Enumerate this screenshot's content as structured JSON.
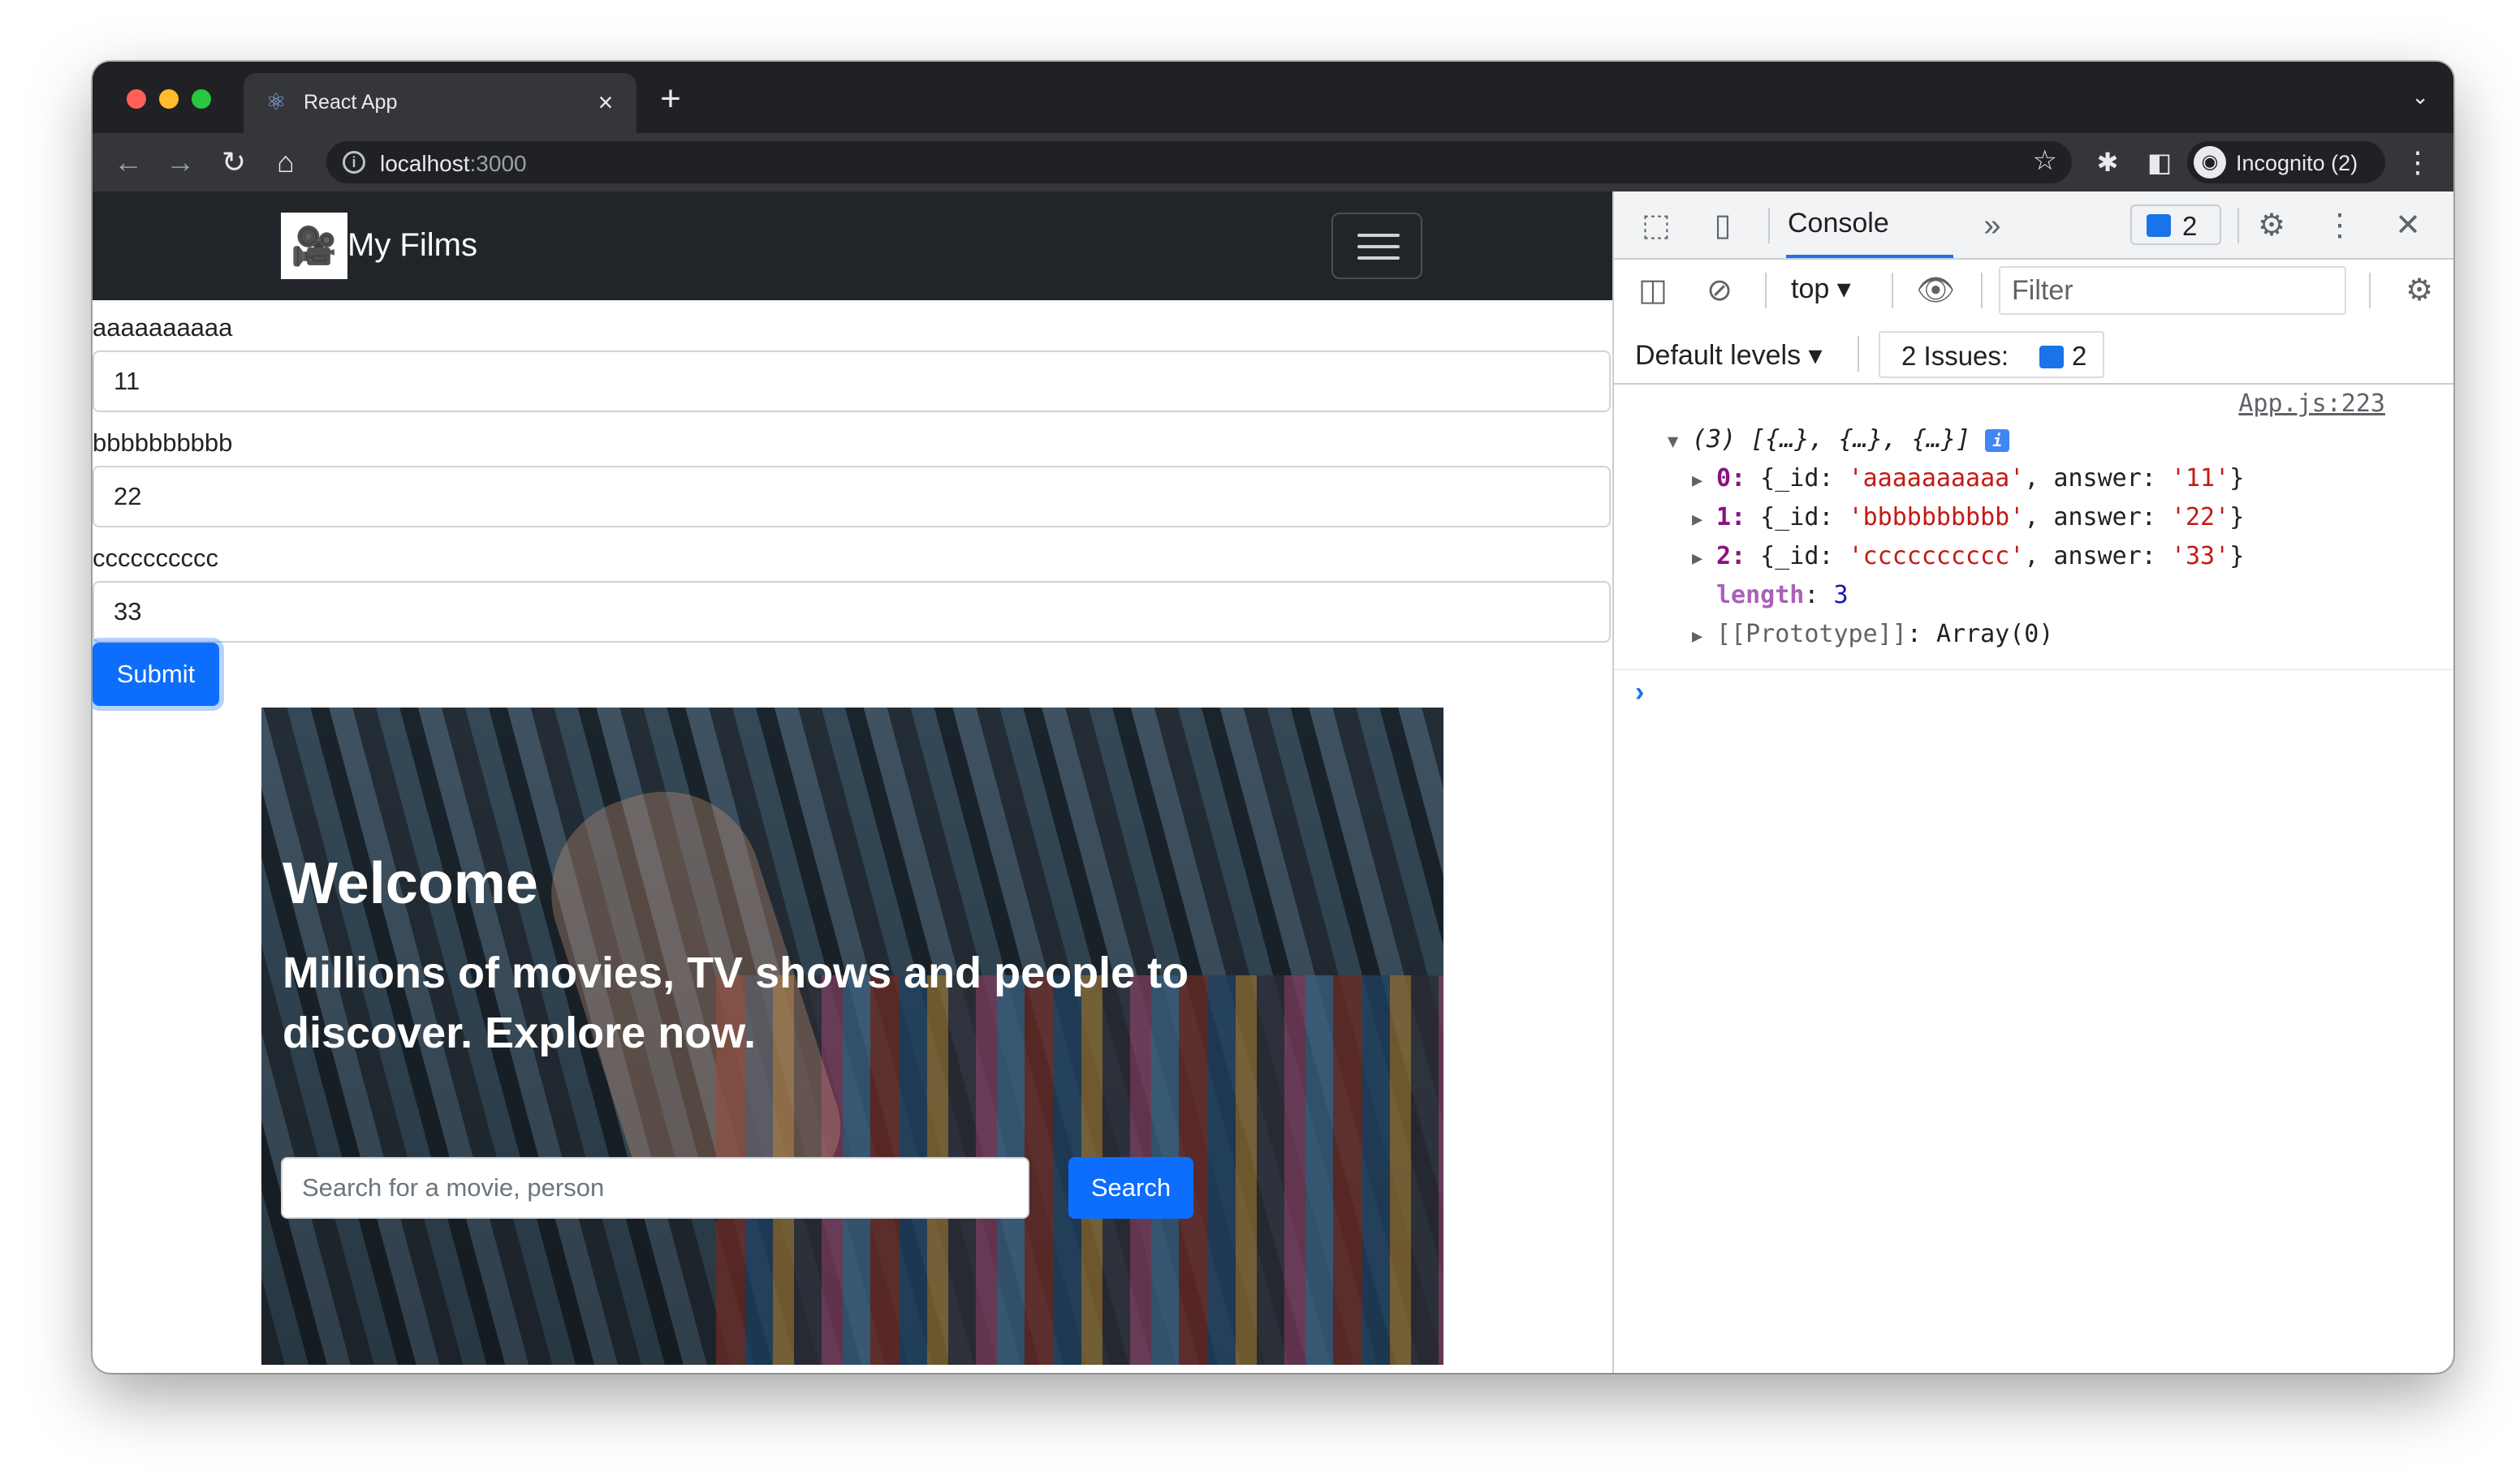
{
  "browser": {
    "tab_title": "React App",
    "tab_close": "×",
    "new_tab": "+",
    "url_host": "localhost",
    "url_port": ":3000",
    "incognito_label": "Incognito (2)",
    "icons": [
      "back-icon",
      "forward-icon",
      "reload-icon",
      "home-icon",
      "info-icon",
      "star-icon",
      "extensions-icon",
      "sidepanel-icon",
      "menu-icon"
    ]
  },
  "navbar": {
    "brand": "My Films"
  },
  "form": {
    "fields": [
      {
        "label": "aaaaaaaaaa",
        "value": "11"
      },
      {
        "label": "bbbbbbbbbb",
        "value": "22"
      },
      {
        "label": "cccccccccc",
        "value": "33"
      }
    ],
    "submit_label": "Submit"
  },
  "hero": {
    "title": "Welcome",
    "subtitle": "Millions of movies, TV shows and people to discover. Explore now.",
    "search_placeholder": "Search for a movie, person",
    "search_button": "Search"
  },
  "devtools": {
    "console_tab": "Console",
    "more_tabs": "»",
    "badge_count": "2",
    "context": "top",
    "filter_placeholder": "Filter",
    "default_levels": "Default levels",
    "issues_label": "2 Issues:",
    "issues_count": "2",
    "source_link": "App.js:223",
    "array_summary": "(3) [{…}, {…}, {…}]",
    "info_badge": "i",
    "entries": [
      {
        "index": "0",
        "id": "'aaaaaaaaaa'",
        "answer": "'11'"
      },
      {
        "index": "1",
        "id": "'bbbbbbbbbb'",
        "answer": "'22'"
      },
      {
        "index": "2",
        "id": "'cccccccccc'",
        "answer": "'33'"
      }
    ],
    "length_key": "length",
    "length_value": "3",
    "prototype_key": "[[Prototype]]",
    "prototype_value": "Array(0)",
    "prompt": "›"
  }
}
